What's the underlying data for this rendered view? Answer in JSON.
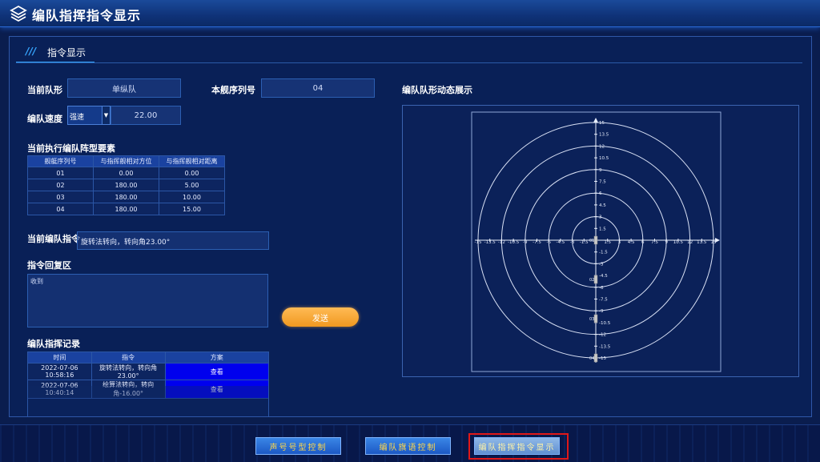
{
  "header": {
    "title": "编队指挥指令显示"
  },
  "tab": {
    "slashes": "///",
    "label": "指令显示"
  },
  "form": {
    "formation_label": "当前队形",
    "formation_value": "单纵队",
    "ship_no_label": "本舰序列号",
    "ship_no_value": "04",
    "speed_label": "编队速度",
    "speed_mode": "强速",
    "speed_value": "22.00",
    "elements_label": "当前执行编队阵型要素",
    "current_cmd_label": "当前编队指令",
    "current_cmd_value": "旋转法转向，转向角23.00°",
    "reply_label": "指令回复区",
    "reply_value": "收到",
    "send_label": "发送",
    "record_label": "编队指挥记录",
    "dynamic_label": "编队队形动态展示"
  },
  "elements_table": {
    "headers": [
      "舰艇序列号",
      "与指挥舰相对方位",
      "与指挥舰相对距离"
    ],
    "rows": [
      [
        "01",
        "0.00",
        "0.00"
      ],
      [
        "02",
        "180.00",
        "5.00"
      ],
      [
        "03",
        "180.00",
        "10.00"
      ],
      [
        "04",
        "180.00",
        "15.00"
      ]
    ]
  },
  "record_table": {
    "headers": [
      "时间",
      "指令",
      "方案"
    ],
    "rows": [
      [
        "2022-07-06 10:58:16",
        "旋转法转向，转向角23.00°",
        "查看"
      ],
      [
        "2022-07-06 10:40:14",
        "绘算法转向，转向角-16.00°",
        "查看"
      ]
    ]
  },
  "chart_data": {
    "type": "scatter",
    "title": "",
    "xlim": [
      -15,
      15
    ],
    "ylim": [
      -15,
      15
    ],
    "x_ticks": [
      "-15",
      "-13.5",
      "-12",
      "-10.5",
      "-9",
      "-7.5",
      "-6",
      "-4.5",
      "-3",
      "-1.5",
      "0",
      "1.5",
      "3",
      "4.5",
      "6",
      "7.5",
      "9",
      "10.5",
      "12",
      "13.5",
      "15"
    ],
    "y_ticks_pos": [
      "15",
      "13.5",
      "12",
      "10.5",
      "9",
      "7.5",
      "6",
      "4.5",
      "3",
      "1.5"
    ],
    "y_ticks_neg": [
      "-1.5",
      "-3",
      "-4.5",
      "-6",
      "-7.5",
      "-9",
      "-10.5",
      "-12",
      "-13.5",
      "-15"
    ],
    "range_rings": [
      3,
      6,
      9,
      12,
      15
    ],
    "points": [
      {
        "label": "01",
        "x": 0,
        "y": 0
      },
      {
        "label": "02",
        "x": 0,
        "y": -5
      },
      {
        "label": "03",
        "x": 0,
        "y": -10
      },
      {
        "label": "04",
        "x": 0,
        "y": -15
      }
    ],
    "grid": false
  },
  "nav": {
    "btn1": "声号号型控制",
    "btn2": "编队旗语控制",
    "btn3": "编队指挥指令显示"
  },
  "colors": {
    "accent": "#37a6ff",
    "send": "#f09820",
    "highlight": "#e01818"
  }
}
